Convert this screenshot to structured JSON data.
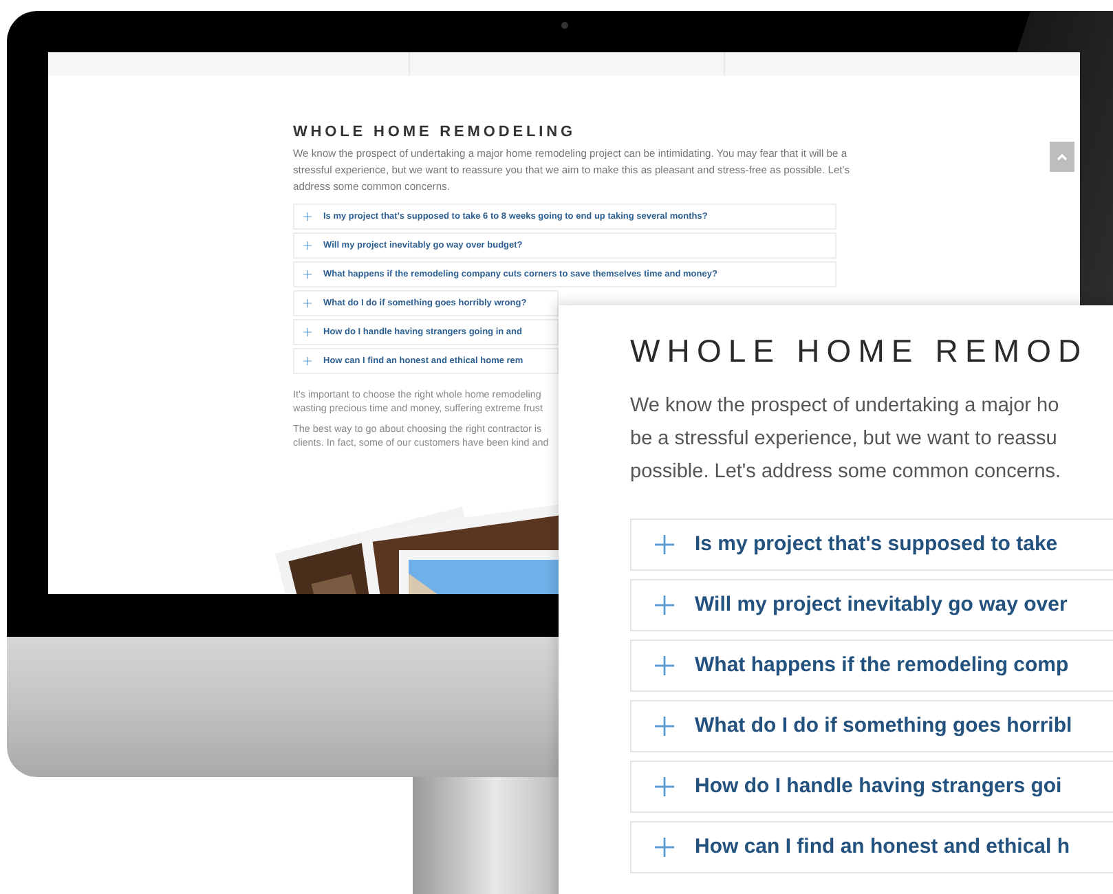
{
  "monitor_page": {
    "heading": "WHOLE HOME REMODELING",
    "intro": "We know the prospect of undertaking a major home remodeling project can be intimidating. You may fear that it will be a stressful experience, but we want to reassure you that we aim to make this as pleasant and stress-free as possible. Let's address some common concerns.",
    "faq": [
      {
        "question": "Is my project that's supposed to take 6 to 8 weeks going to end up taking several months?"
      },
      {
        "question": "Will my project inevitably go way over budget?"
      },
      {
        "question": "What happens if the remodeling company cuts corners to save themselves time and money?"
      },
      {
        "question": "What do I do if something goes horribly wrong?"
      },
      {
        "question": "How do I handle having strangers going in and"
      },
      {
        "question": "How can I find an honest and ethical home rem"
      }
    ],
    "paragraphs": [
      [
        "It's important to choose the right whole home remodeling",
        "wasting precious time and money, suffering extreme frust"
      ],
      [
        "The best way to go about choosing the right contractor is",
        "clients. In fact, some of our customers have been kind and"
      ]
    ]
  },
  "zoom_inset": {
    "heading": "WHOLE HOME REMOD",
    "intro_lines": [
      "We know the prospect of undertaking a major ho",
      "be a stressful experience, but we want to reassu",
      "possible. Let's address some common concerns."
    ],
    "faq": [
      {
        "question": "Is my project that's supposed to take"
      },
      {
        "question": "Will my project inevitably go way over"
      },
      {
        "question": "What happens if the remodeling comp"
      },
      {
        "question": "What do I do if something goes horribl"
      },
      {
        "question": "How do I handle having strangers goi"
      },
      {
        "question": "How can I find an honest and ethical h"
      }
    ]
  }
}
